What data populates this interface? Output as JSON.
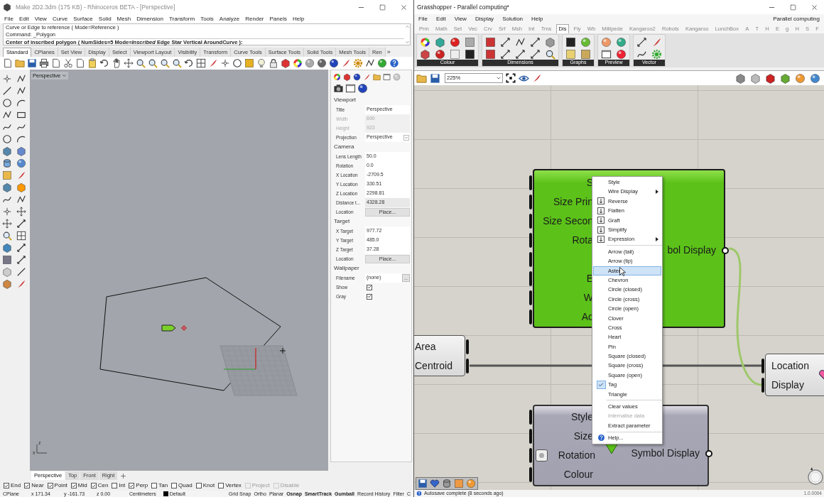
{
  "rhino": {
    "title": "Make 2D2.3dm (175 KB) - Rhinoceros BETA - [Perspective]",
    "menu": [
      "File",
      "Edit",
      "View",
      "Curve",
      "Surface",
      "Solid",
      "Mesh",
      "Dimension",
      "Transform",
      "Tools",
      "Analyze",
      "Render",
      "Panels",
      "Help"
    ],
    "command_history": [
      "Curve or Edge to reference ( Mode=Reference )",
      "Command: _Polygon"
    ],
    "prompt": "Center of inscribed polygon ( NumSides=5 Mode=*Inscribed* Edge Star Vertical AroundCurve ):",
    "toolbar_tabs": [
      {
        "label": "Standard",
        "selected": true
      },
      {
        "label": "CPlanes",
        "selected": false
      },
      {
        "label": "Set View",
        "selected": false
      },
      {
        "label": "Display",
        "selected": false
      },
      {
        "label": "Select",
        "selected": false
      },
      {
        "label": "Viewport Layout",
        "selected": false
      },
      {
        "label": "Visibility",
        "selected": false
      },
      {
        "label": "Transform",
        "selected": false
      },
      {
        "label": "Curve Tools",
        "selected": false
      },
      {
        "label": "Surface Tools",
        "selected": false
      },
      {
        "label": "Solid Tools",
        "selected": false
      },
      {
        "label": "Mesh Tools",
        "selected": false
      },
      {
        "label": "Ren",
        "selected": false
      }
    ],
    "toolbar_overflow": "»",
    "viewport": {
      "title": "Perspective",
      "axis_labels": [
        "z",
        "x"
      ]
    },
    "properties": {
      "sections": [
        {
          "title": "Viewport",
          "rows": [
            {
              "label": "Title",
              "value": "Perspective",
              "kind": "text",
              "disabled": false
            },
            {
              "label": "Width",
              "value": "690",
              "kind": "text",
              "disabled": true
            },
            {
              "label": "Height",
              "value": "923",
              "kind": "text",
              "disabled": true
            },
            {
              "label": "Projection",
              "value": "Perspective",
              "kind": "dropdown",
              "disabled": false
            }
          ]
        },
        {
          "title": "Camera",
          "rows": [
            {
              "label": "Lens Length",
              "value": "50.0",
              "kind": "text",
              "disabled": false
            },
            {
              "label": "Rotation",
              "value": "0.0",
              "kind": "text",
              "disabled": false
            },
            {
              "label": "X Location",
              "value": "-2709.5",
              "kind": "text",
              "disabled": false
            },
            {
              "label": "Y Location",
              "value": "330.51",
              "kind": "text",
              "disabled": false
            },
            {
              "label": "Z Location",
              "value": "2298.81",
              "kind": "text",
              "disabled": false
            },
            {
              "label": "Distance t...",
              "value": "4328.28",
              "kind": "readonly",
              "disabled": false
            },
            {
              "label": "Location",
              "value": "Place...",
              "kind": "button",
              "disabled": false
            }
          ]
        },
        {
          "title": "Target",
          "rows": [
            {
              "label": "X Target",
              "value": "977.72",
              "kind": "text",
              "disabled": false
            },
            {
              "label": "Y Target",
              "value": "485.0",
              "kind": "text",
              "disabled": false
            },
            {
              "label": "Z Target",
              "value": "37.28",
              "kind": "text",
              "disabled": false
            },
            {
              "label": "Location",
              "value": "Place...",
              "kind": "button",
              "disabled": false
            }
          ]
        },
        {
          "title": "Wallpaper",
          "rows": [
            {
              "label": "Filename",
              "value": "(none)",
              "kind": "browse",
              "button": "...",
              "disabled": false
            },
            {
              "label": "Show",
              "kind": "checkbox",
              "checked": true,
              "disabled": false
            },
            {
              "label": "Gray",
              "kind": "checkbox",
              "checked": true,
              "disabled": false
            }
          ]
        }
      ]
    },
    "viewport_tabs": [
      {
        "label": "Perspective",
        "selected": true
      },
      {
        "label": "Top",
        "selected": false
      },
      {
        "label": "Front",
        "selected": false
      },
      {
        "label": "Right",
        "selected": false
      }
    ],
    "osnaps": [
      {
        "label": "End",
        "checked": true,
        "disabled": false
      },
      {
        "label": "Near",
        "checked": true,
        "disabled": false
      },
      {
        "label": "Point",
        "checked": true,
        "disabled": false
      },
      {
        "label": "Mid",
        "checked": true,
        "disabled": false
      },
      {
        "label": "Cen",
        "checked": true,
        "disabled": false
      },
      {
        "label": "Int",
        "checked": false,
        "disabled": false
      },
      {
        "label": "Perp",
        "checked": true,
        "disabled": false
      },
      {
        "label": "Tan",
        "checked": false,
        "disabled": false
      },
      {
        "label": "Quad",
        "checked": false,
        "disabled": false
      },
      {
        "label": "Knot",
        "checked": false,
        "disabled": false
      },
      {
        "label": "Vertex",
        "checked": false,
        "disabled": false
      },
      {
        "label": "Project",
        "checked": false,
        "disabled": true
      },
      {
        "label": "Disable",
        "checked": false,
        "disabled": true
      }
    ],
    "status_bar": {
      "cplane": "CPlane",
      "coordinates": [
        "x 171.34",
        "y -161.73",
        "z 0.00"
      ],
      "units": "Centimeters",
      "layer": {
        "name": "Default",
        "color": "#000000"
      },
      "panes": [
        {
          "label": "Grid Snap",
          "active": false
        },
        {
          "label": "Ortho",
          "active": false
        },
        {
          "label": "Planar",
          "active": false
        },
        {
          "label": "Osnap",
          "active": true
        },
        {
          "label": "SmartTrack",
          "active": true
        },
        {
          "label": "Gumball",
          "active": true
        },
        {
          "label": "Record History",
          "active": false
        },
        {
          "label": "Filter",
          "active": false
        },
        {
          "label": "C",
          "active": false
        }
      ]
    }
  },
  "grasshopper": {
    "title": "Grasshopper - Parallel computing*",
    "menu": [
      "File",
      "Edit",
      "View",
      "Display",
      "Solution",
      "Help"
    ],
    "document": "Parallel computing",
    "tabs": [
      {
        "label": "Prm",
        "selected": false
      },
      {
        "label": "Math",
        "selected": false
      },
      {
        "label": "Set",
        "selected": false
      },
      {
        "label": "Vec",
        "selected": false
      },
      {
        "label": "Crv",
        "selected": false
      },
      {
        "label": "Srf",
        "selected": false
      },
      {
        "label": "Msh",
        "selected": false
      },
      {
        "label": "Int",
        "selected": false
      },
      {
        "label": "Trns",
        "selected": false
      },
      {
        "label": "Dis",
        "selected": true
      },
      {
        "label": "Fly",
        "selected": false
      },
      {
        "label": "Wb",
        "selected": false
      },
      {
        "label": "Millipede",
        "selected": false
      },
      {
        "label": "Kangaroo2",
        "selected": false
      },
      {
        "label": "Robots",
        "selected": false
      },
      {
        "label": "Kangaroo",
        "selected": false
      },
      {
        "label": "LunchBox",
        "selected": false
      },
      {
        "label": "A",
        "selected": false
      },
      {
        "label": "T",
        "selected": false
      },
      {
        "label": "H",
        "selected": false
      },
      {
        "label": "E",
        "selected": false
      },
      {
        "label": "g",
        "selected": false
      },
      {
        "label": "H",
        "selected": false
      },
      {
        "label": "S",
        "selected": false
      },
      {
        "label": "F",
        "selected": false
      }
    ],
    "panels": [
      "Colour",
      "Dimensions",
      "Graphs",
      "Preview",
      "Vector"
    ],
    "zoom": "225%",
    "nodes": {
      "symbol_display": {
        "inputs": [
          {
            "kind": "labeled",
            "label": "S"
          },
          {
            "kind": "labeled",
            "label": "Size Prin"
          },
          {
            "kind": "labeled",
            "label": "Size Secon"
          },
          {
            "kind": "labeled",
            "label": "Rota"
          },
          {
            "kind": "port_only"
          },
          {
            "kind": "labeled",
            "label": "E"
          },
          {
            "kind": "labeled",
            "label": "W"
          },
          {
            "kind": "labeled",
            "label": "Ac"
          }
        ],
        "output": "bol Display"
      },
      "area": {
        "outputs": [
          "Area",
          "Centroid"
        ]
      },
      "target": {
        "inputs": [
          "Location",
          "Display"
        ]
      },
      "symbol_display_2": {
        "inputs": [
          {
            "label": "Style",
            "kind": "plain"
          },
          {
            "label": "Size",
            "kind": "plain"
          },
          {
            "label": "Rotation",
            "kind": "internal"
          },
          {
            "label": "Colour",
            "kind": "plain"
          }
        ],
        "output": "Symbol Display"
      }
    },
    "context_menu": [
      {
        "kind": "plain",
        "label": "Style",
        "selected": false,
        "checked": false,
        "disabled": false,
        "submenu": false
      },
      {
        "kind": "plain",
        "label": "Wire Display",
        "selected": false,
        "checked": false,
        "disabled": false,
        "submenu": true
      },
      {
        "kind": "with_icon",
        "label": "Reverse",
        "selected": false,
        "checked": false,
        "disabled": false,
        "submenu": false
      },
      {
        "kind": "with_icon",
        "label": "Flatten",
        "selected": false,
        "checked": false,
        "disabled": false,
        "submenu": false
      },
      {
        "kind": "with_icon",
        "label": "Graft",
        "selected": false,
        "checked": false,
        "disabled": false,
        "submenu": false
      },
      {
        "kind": "with_icon",
        "label": "Simplify",
        "selected": false,
        "checked": false,
        "disabled": false,
        "submenu": false
      },
      {
        "kind": "with_icon",
        "label": "Expression",
        "selected": false,
        "checked": false,
        "disabled": false,
        "submenu": true
      },
      {
        "kind": "separator"
      },
      {
        "kind": "plain",
        "label": "Arrow (tail)",
        "selected": false,
        "checked": false,
        "disabled": false,
        "submenu": false
      },
      {
        "kind": "plain",
        "label": "Arrow (tip)",
        "selected": false,
        "checked": false,
        "disabled": false,
        "submenu": false
      },
      {
        "kind": "plain",
        "label": "Aster",
        "selected": true,
        "checked": false,
        "disabled": false,
        "submenu": false
      },
      {
        "kind": "plain",
        "label": "Chevron",
        "selected": false,
        "checked": false,
        "disabled": false,
        "submenu": false
      },
      {
        "kind": "plain",
        "label": "Circle (closed)",
        "selected": false,
        "checked": false,
        "disabled": false,
        "submenu": false
      },
      {
        "kind": "plain",
        "label": "Circle (cross)",
        "selected": false,
        "checked": false,
        "disabled": false,
        "submenu": false
      },
      {
        "kind": "plain",
        "label": "Circle (open)",
        "selected": false,
        "checked": false,
        "disabled": false,
        "submenu": false
      },
      {
        "kind": "plain",
        "label": "Clover",
        "selected": false,
        "checked": false,
        "disabled": false,
        "submenu": false
      },
      {
        "kind": "plain",
        "label": "Cross",
        "selected": false,
        "checked": false,
        "disabled": false,
        "submenu": false
      },
      {
        "kind": "plain",
        "label": "Heart",
        "selected": false,
        "checked": false,
        "disabled": false,
        "submenu": false
      },
      {
        "kind": "plain",
        "label": "Pin",
        "selected": false,
        "checked": false,
        "disabled": false,
        "submenu": false
      },
      {
        "kind": "plain",
        "label": "Square (closed)",
        "selected": false,
        "checked": false,
        "disabled": false,
        "submenu": false
      },
      {
        "kind": "plain",
        "label": "Square (cross)",
        "selected": false,
        "checked": false,
        "disabled": false,
        "submenu": false
      },
      {
        "kind": "plain",
        "label": "Square (open)",
        "selected": false,
        "checked": false,
        "disabled": false,
        "submenu": false
      },
      {
        "kind": "plain",
        "label": "Tag",
        "selected": false,
        "checked": true,
        "disabled": false,
        "submenu": false
      },
      {
        "kind": "plain",
        "label": "Triangle",
        "selected": false,
        "checked": false,
        "disabled": false,
        "submenu": false
      },
      {
        "kind": "separator"
      },
      {
        "kind": "plain",
        "label": "Clear values",
        "selected": false,
        "checked": false,
        "disabled": false,
        "submenu": false
      },
      {
        "kind": "plain",
        "label": "Internalise data",
        "selected": false,
        "checked": false,
        "disabled": true,
        "submenu": false
      },
      {
        "kind": "plain",
        "label": "Extract parameter",
        "selected": false,
        "checked": false,
        "disabled": false,
        "submenu": false
      },
      {
        "kind": "separator"
      },
      {
        "kind": "help",
        "label": "Help...",
        "selected": false,
        "checked": false,
        "disabled": false,
        "submenu": false
      }
    ],
    "status": "Autosave complete (8 seconds ago)",
    "version": "1.0.0004"
  }
}
